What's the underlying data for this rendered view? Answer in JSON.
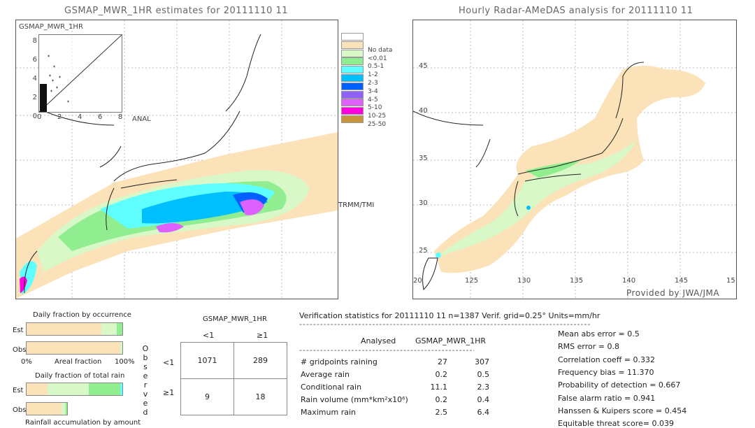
{
  "left_map": {
    "title": "GSMAP_MWR_1HR estimates for 20111110 11",
    "inset_ylabel": "GSMAP_MWR_1HR",
    "inset_xlabel": "ANAL",
    "inset_yticks": [
      "8",
      "6",
      "4",
      "2",
      "0"
    ],
    "inset_xticks": [
      "0",
      "2",
      "4",
      "6",
      "8"
    ],
    "swath_label": "TRMM/TMI"
  },
  "legend": {
    "items": [
      {
        "label": "",
        "color": "#ffffff"
      },
      {
        "label": "No data",
        "color": "#fbe2b8"
      },
      {
        "label": "<0.01",
        "color": "#d8f8c8"
      },
      {
        "label": "0.5-1",
        "color": "#90ee90"
      },
      {
        "label": "1-2",
        "color": "#60ffff"
      },
      {
        "label": "2-3",
        "color": "#00bfff"
      },
      {
        "label": "3-4",
        "color": "#0060ff"
      },
      {
        "label": "4-5",
        "color": "#9060ff"
      },
      {
        "label": "5-10",
        "color": "#dd60ff"
      },
      {
        "label": "10-25",
        "color": "#ff00e0"
      },
      {
        "label": "25-50",
        "color": "#c8963c"
      }
    ]
  },
  "right_map": {
    "title": "Hourly Radar-AMeDAS analysis for 20111110 11",
    "lat_labels": [
      "45",
      "40",
      "35",
      "30",
      "25"
    ],
    "lon_labels": [
      "20",
      "125",
      "130",
      "135",
      "140",
      "145",
      "15"
    ],
    "credit": "Provided by JWA/JMA"
  },
  "occurrence": {
    "title": "Daily fraction by occurrence",
    "est_label": "Est",
    "obs_label": "Obs",
    "axis_left": "0%",
    "axis_mid": "Areal fraction",
    "axis_right": "100%",
    "est_fractions": [
      0.78,
      0.16,
      0.06
    ],
    "obs_fractions": [
      0.98,
      0.02
    ]
  },
  "total_rain": {
    "title": "Daily fraction of total rain",
    "est_label": "Est",
    "obs_label": "Obs",
    "footer": "Rainfall accumulation by amount",
    "est_fractions": [
      0.22,
      0.43,
      0.33,
      0.02
    ],
    "obs_fractions": [
      0.86,
      0.1,
      0.04
    ]
  },
  "contingency": {
    "header": "GSMAP_MWR_1HR",
    "col_labels": [
      "<1",
      "≥1"
    ],
    "row_labels": [
      "<1",
      "≥1"
    ],
    "side_label": "Observed",
    "cells": [
      [
        "1071",
        "289"
      ],
      [
        "9",
        "18"
      ]
    ]
  },
  "stats": {
    "header": "Verification statistics for 20111110 11   n=1387   Verif. grid=0.25°   Units=mm/hr",
    "dashes": "------------------------------------------------------------------------------------",
    "col_analysed": "Analysed",
    "col_est": "GSMAP_MWR_1HR",
    "rows": [
      {
        "label": "# gridpoints raining",
        "a": "27",
        "e": "307"
      },
      {
        "label": "Average rain",
        "a": "0.2",
        "e": "0.5"
      },
      {
        "label": "Conditional rain",
        "a": "11.1",
        "e": "2.3"
      },
      {
        "label": "Rain volume (mm*km²x10⁶)",
        "a": "0.2",
        "e": "0.4"
      },
      {
        "label": "Maximum rain",
        "a": "2.5",
        "e": "6.4"
      }
    ],
    "scores": [
      "Mean abs error = 0.5",
      "RMS error = 0.8",
      "Correlation coeff = 0.332",
      "Frequency bias = 11.370",
      "Probability of detection = 0.667",
      "False alarm ratio = 0.941",
      "Hanssen & Kuipers score = 0.454",
      "Equitable threat score= 0.039"
    ]
  }
}
